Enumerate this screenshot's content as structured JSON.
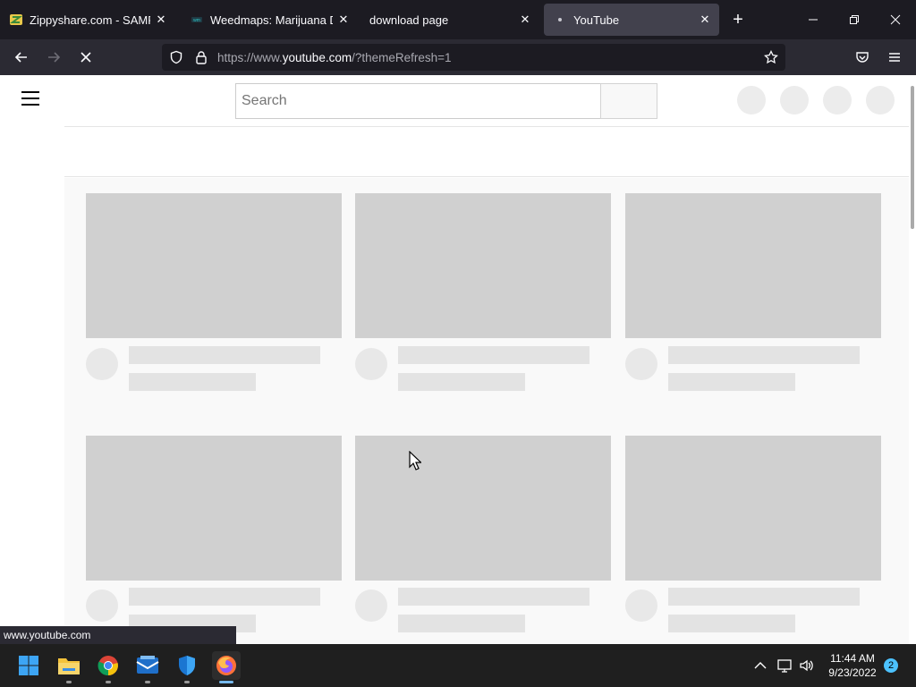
{
  "browser": {
    "tabs": [
      {
        "title": "Zippyshare.com - SAMPFUl",
        "favicon": "zippyshare-icon",
        "active": false
      },
      {
        "title": "Weedmaps: Marijuana Disp",
        "favicon": "weedmaps-icon",
        "active": false
      },
      {
        "title": "download page",
        "favicon": "",
        "active": false
      },
      {
        "title": "YouTube",
        "favicon": "loading-dot-icon",
        "active": true
      }
    ],
    "url": {
      "prefix": "https://www.",
      "domain": "youtube.com",
      "suffix": "/?themeRefresh=1"
    },
    "status_link": "www.youtube.com"
  },
  "youtube": {
    "search_placeholder": "Search"
  },
  "taskbar": {
    "time": "11:44 AM",
    "date": "9/23/2022",
    "notification_count": "2",
    "apps": [
      "windows-start-icon",
      "file-explorer-icon",
      "chrome-icon",
      "mail-icon",
      "defender-icon",
      "firefox-icon"
    ]
  },
  "colors": {
    "tab_strip": "#1c1b22",
    "nav_bar": "#2b2a33",
    "skeleton_thumb": "#d0d0d0",
    "skeleton_line": "#e3e3e3",
    "taskbar": "#1f1f1f",
    "accent": "#76b9ed"
  }
}
